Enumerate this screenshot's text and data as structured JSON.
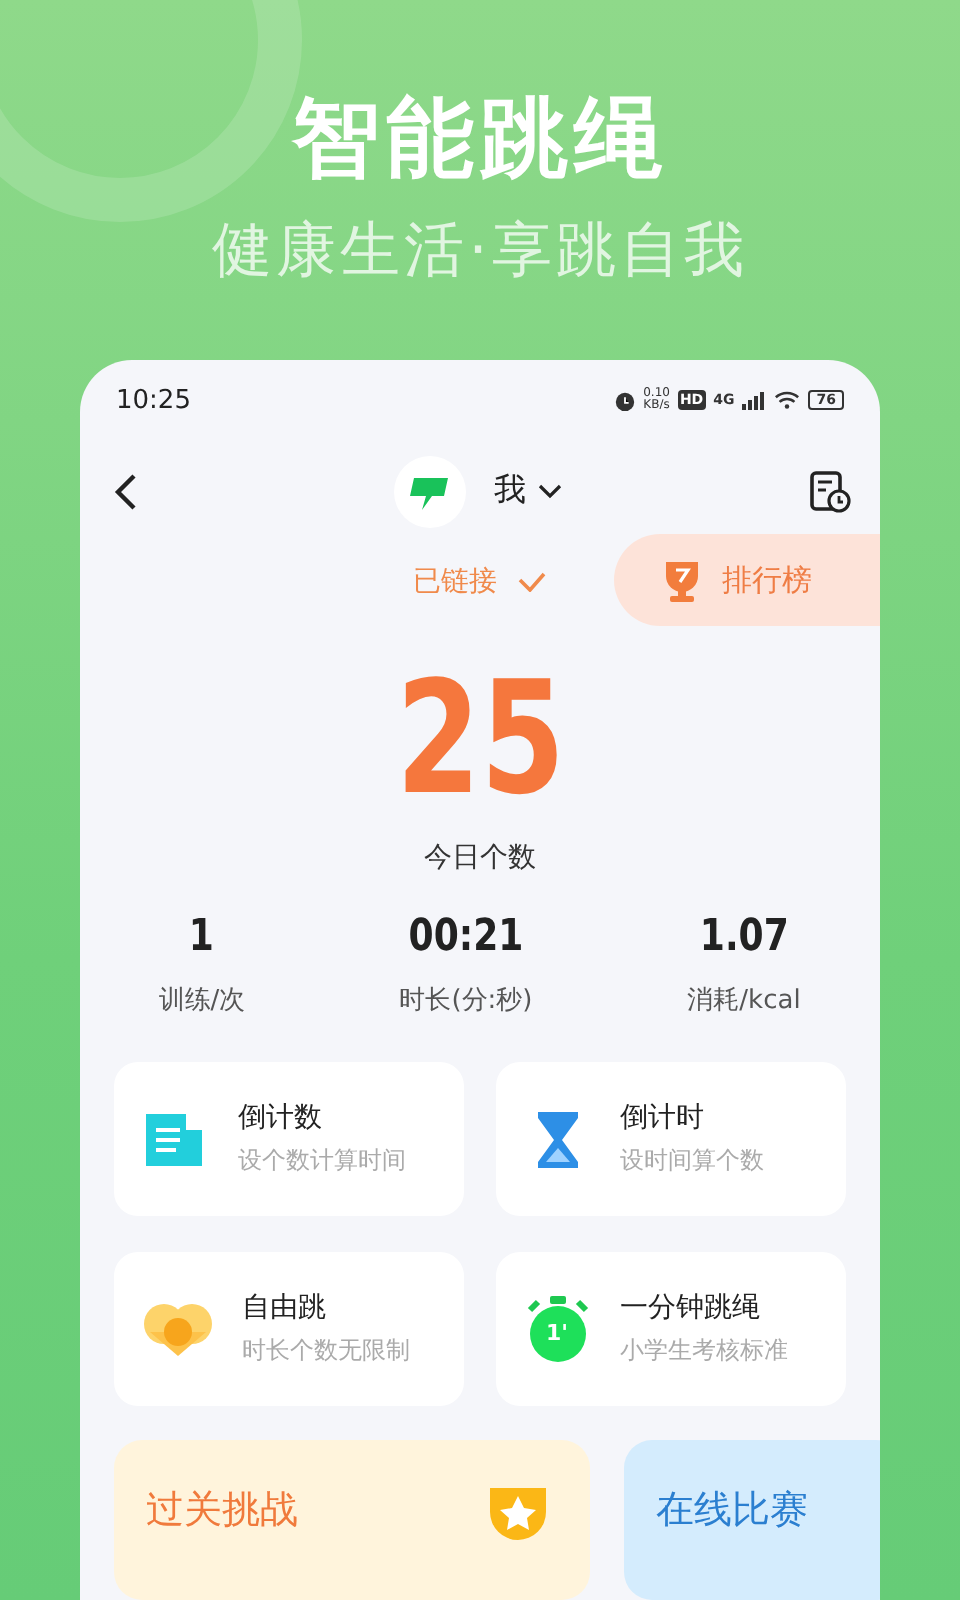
{
  "hero": {
    "title": "智能跳绳",
    "subtitle": "健康生活·享跳自我"
  },
  "status_bar": {
    "time": "10:25",
    "net_speed": "0.10",
    "net_unit": "KB/s",
    "hd": "HD",
    "network": "4G",
    "battery": "76"
  },
  "header": {
    "user": "我"
  },
  "connection": {
    "label": "已链接",
    "connected": true
  },
  "leaderboard": {
    "label": "排行榜"
  },
  "today": {
    "count": "25",
    "label": "今日个数"
  },
  "stats": [
    {
      "value": "1",
      "label": "训练/次"
    },
    {
      "value": "00:21",
      "label": "时长(分:秒)"
    },
    {
      "value": "1.07",
      "label": "消耗/kcal"
    }
  ],
  "modes": [
    {
      "kind": "count",
      "title": "倒计数",
      "subtitle": "设个数计算时间"
    },
    {
      "kind": "timer",
      "title": "倒计时",
      "subtitle": "设时间算个数"
    },
    {
      "kind": "free",
      "title": "自由跳",
      "subtitle": "时长个数无限制"
    },
    {
      "kind": "minute",
      "title": "一分钟跳绳",
      "subtitle": "小学生考核标准",
      "badge": "1'"
    }
  ],
  "challenges": [
    {
      "kind": "level",
      "title": "过关挑战"
    },
    {
      "kind": "online",
      "title": "在线比赛"
    }
  ]
}
